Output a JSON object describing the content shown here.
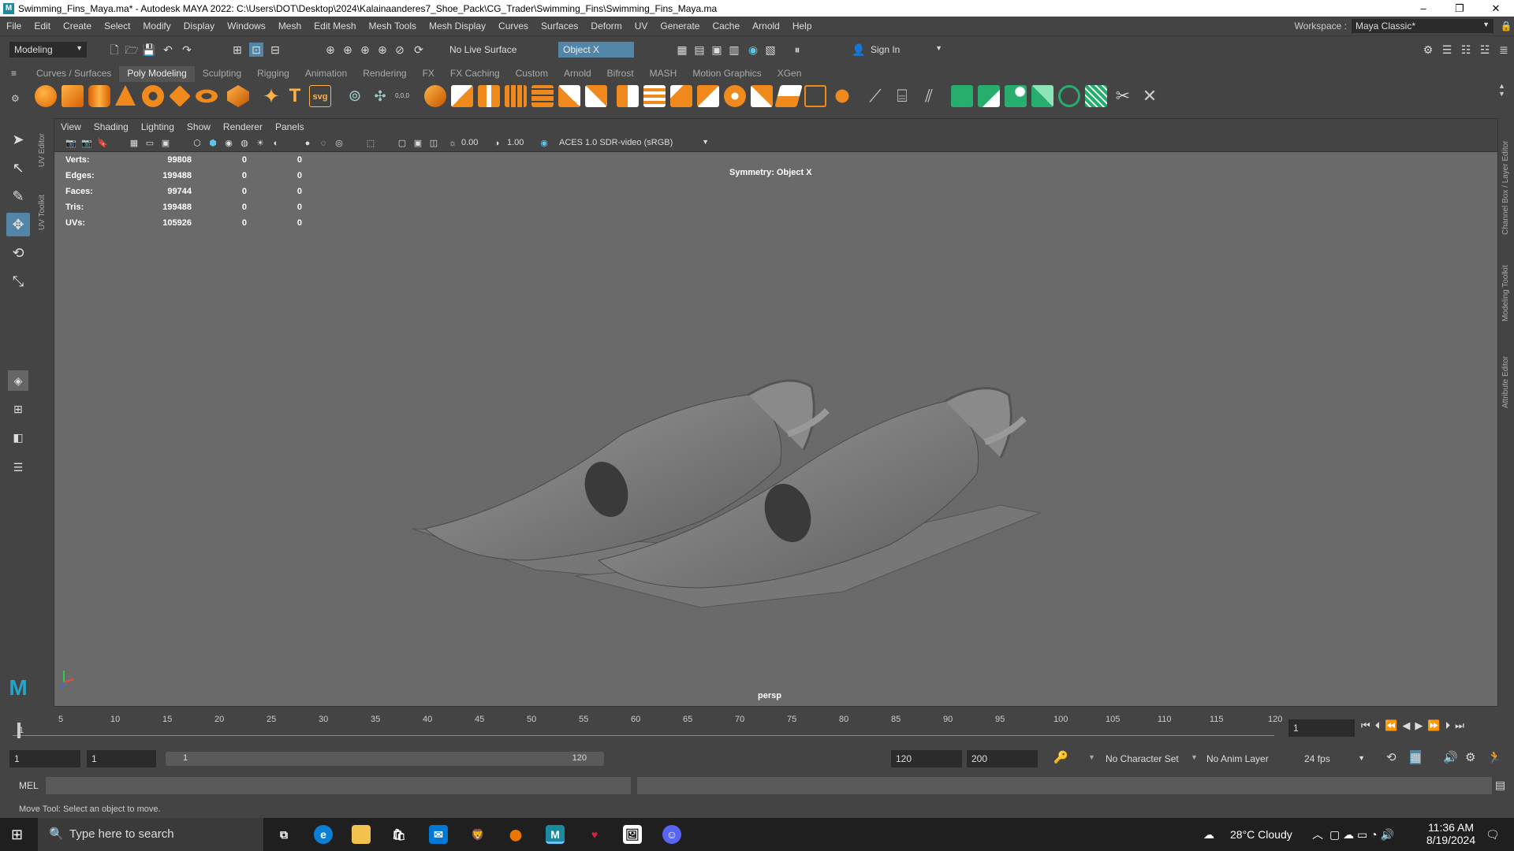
{
  "title": {
    "text": "Swimming_Fins_Maya.ma* - Autodesk MAYA 2022: C:\\Users\\DOT\\Desktop\\2024\\Kalainaanderes7_Shoe_Pack\\CG_Trader\\Swimming_Fins\\Swimming_Fins_Maya.ma",
    "minimize": "–",
    "restore": "❐",
    "close": "✕"
  },
  "menu": [
    "File",
    "Edit",
    "Create",
    "Select",
    "Modify",
    "Display",
    "Windows",
    "Mesh",
    "Edit Mesh",
    "Mesh Tools",
    "Mesh Display",
    "Curves",
    "Surfaces",
    "Deform",
    "UV",
    "Generate",
    "Cache",
    "Arnold",
    "Help"
  ],
  "workspace": {
    "label": "Workspace :",
    "value": "Maya Classic*"
  },
  "statusline": {
    "mode": "Modeling",
    "live_surface": "No Live Surface",
    "symmetry": "Object X",
    "sign_in": "Sign In"
  },
  "shelf_tabs": [
    "Curves / Surfaces",
    "Poly Modeling",
    "Sculpting",
    "Rigging",
    "Animation",
    "Rendering",
    "FX",
    "FX Caching",
    "Custom",
    "Arnold",
    "Bifrost",
    "MASH",
    "Motion Graphics",
    "XGen"
  ],
  "active_shelf": "Poly Modeling",
  "shelf_text_icons": {
    "text": "T",
    "svg": "svg",
    "coords": "0,0,0"
  },
  "side_tabs": {
    "uv_editor": "UV Editor",
    "uv_toolkit": "UV Toolkit",
    "channel_box": "Channel Box / Layer Editor",
    "modeling_toolkit": "Modeling Toolkit",
    "attribute_editor": "Attribute Editor"
  },
  "panel_menu": [
    "View",
    "Shading",
    "Lighting",
    "Show",
    "Renderer",
    "Panels"
  ],
  "panel_toolbar": {
    "exposure": "0.00",
    "gamma": "1.00",
    "color_space": "ACES 1.0 SDR-video (sRGB)"
  },
  "hud": [
    {
      "label": "Verts:",
      "value": "99808",
      "sel": "0",
      "comp": "0"
    },
    {
      "label": "Edges:",
      "value": "199488",
      "sel": "0",
      "comp": "0"
    },
    {
      "label": "Faces:",
      "value": "99744",
      "sel": "0",
      "comp": "0"
    },
    {
      "label": "Tris:",
      "value": "199488",
      "sel": "0",
      "comp": "0"
    },
    {
      "label": "UVs:",
      "value": "105926",
      "sel": "0",
      "comp": "0"
    }
  ],
  "symmetry_hud": "Symmetry: Object X",
  "camera": "persp",
  "timeline": {
    "ticks": [
      "1",
      "5",
      "10",
      "15",
      "20",
      "25",
      "30",
      "35",
      "40",
      "45",
      "50",
      "55",
      "60",
      "65",
      "70",
      "75",
      "80",
      "85",
      "90",
      "95",
      "100",
      "105",
      "110",
      "115",
      "120"
    ],
    "current_frame": "1"
  },
  "range": {
    "start": "1",
    "anim_start": "1",
    "slider_start": "1",
    "slider_end": "120",
    "end": "120",
    "anim_end": "200",
    "character_set": "No Character Set",
    "anim_layer": "No Anim Layer",
    "fps": "24 fps"
  },
  "mel_label": "MEL",
  "help_line": "Move Tool: Select an object to move.",
  "taskbar": {
    "search": "Type here to search",
    "weather": "28°C  Cloudy",
    "time": "11:36 AM",
    "date": "8/19/2024"
  }
}
